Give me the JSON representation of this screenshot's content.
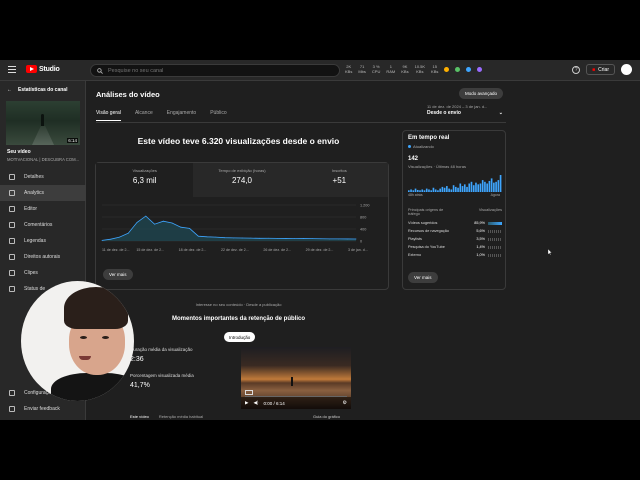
{
  "app": {
    "logo_text": "Studio",
    "search_placeholder": "Pesquise no seu canal",
    "create_label": "Criar",
    "help_glyph": "?"
  },
  "tray": {
    "items": [
      {
        "top": "2K",
        "bottom": "KBs"
      },
      {
        "top": "71",
        "bottom": "Mbs"
      },
      {
        "top": "3 %",
        "bottom": "CPU"
      },
      {
        "top": "1",
        "bottom": "RAM"
      },
      {
        "top": "9K",
        "bottom": "KBs"
      },
      {
        "top": "10.5K",
        "bottom": "KBs"
      },
      {
        "top": "15",
        "bottom": "KBs"
      }
    ]
  },
  "sidebar": {
    "header": "Estatísticas do canal",
    "thumb_duration": "6:14",
    "video_label": "Seu vídeo",
    "video_sub": "MOTIVACIONAL | DESCUBRA COM...",
    "items": [
      {
        "label": "Detalhes",
        "active": false
      },
      {
        "label": "Analytics",
        "active": true
      },
      {
        "label": "Editor",
        "active": false
      },
      {
        "label": "Comentários",
        "active": false
      },
      {
        "label": "Legendas",
        "active": false
      },
      {
        "label": "Direitos autorais",
        "active": false
      },
      {
        "label": "Clipes",
        "active": false
      },
      {
        "label": "Status de",
        "active": false
      }
    ],
    "bottom_items": [
      {
        "label": "Configurações"
      },
      {
        "label": "Enviar feedback"
      }
    ]
  },
  "main": {
    "title": "Análises do vídeo",
    "advanced_button": "Modo avançado",
    "tabs": [
      {
        "label": "Visão geral",
        "active": true
      },
      {
        "label": "Alcance",
        "active": false
      },
      {
        "label": "Engajamento",
        "active": false
      },
      {
        "label": "Público",
        "active": false
      }
    ],
    "date_range_top": "11 de dez. de 2024 – 3 de jan. d...",
    "date_range_main": "Desde o envio",
    "headline": "Este vídeo teve 6.320 visualizações desde o envio",
    "metrics": [
      {
        "label": "Visualizações",
        "value": "6,3 mil"
      },
      {
        "label": "Tempo de exibição (horas)",
        "value": "274,0"
      },
      {
        "label": "Inscritos",
        "value": "+51"
      }
    ],
    "see_more": "Ver mais",
    "footnote": "Interesse no seu conteúdo · Desde a publicação",
    "moments_title": "Momentos importantes da retenção de público",
    "intro_chip": "Introdução",
    "avg_duration_label": "Duração média da visualização",
    "avg_duration_value": "2:36",
    "avg_percent_label": "Porcentagem visualizada média",
    "avg_percent_value": "41,7%",
    "video_time": "0:00 / 6:14",
    "legend_this_video": "Este vídeo",
    "legend_typical": "Retenção média habitual",
    "chart_guide": "Guia do gráfico"
  },
  "realtime": {
    "title": "Em tempo real",
    "live_label": "Atualizando",
    "views_48h": "142",
    "sub_label": "Visualizações · Últimas 48 horas",
    "axis_left": "48h atrás",
    "axis_right": "Agora",
    "table_head_source": "Principais origens de tráfego",
    "table_head_views": "Visualizações",
    "sources": [
      {
        "name": "Vídeos sugeridos",
        "pct": "85,9%"
      },
      {
        "name": "Recursos de navegação",
        "pct": "5,6%"
      },
      {
        "name": "Playlists",
        "pct": "3,5%"
      },
      {
        "name": "Pesquisa do YouTube",
        "pct": "1,4%"
      },
      {
        "name": "Externo",
        "pct": "1,0%"
      }
    ],
    "see_more": "Ver mais",
    "bar_values": [
      0.1,
      0.15,
      0.1,
      0.2,
      0.12,
      0.1,
      0.15,
      0.1,
      0.2,
      0.15,
      0.1,
      0.25,
      0.15,
      0.1,
      0.2,
      0.3,
      0.25,
      0.35,
      0.2,
      0.15,
      0.4,
      0.3,
      0.25,
      0.5,
      0.35,
      0.45,
      0.3,
      0.5,
      0.6,
      0.4,
      0.55,
      0.45,
      0.5,
      0.7,
      0.6,
      0.5,
      0.65,
      0.8,
      0.55,
      0.6,
      0.7,
      1.0
    ]
  },
  "chart_data": {
    "type": "area",
    "x": [
      "11 de dez. de 2...",
      "15 de dez. de 2...",
      "18 de dez. de 2...",
      "22 de dez. de 2...",
      "26 de dez. de 2...",
      "29 de dez. de 2...",
      "3 de jan. d..."
    ],
    "series": [
      {
        "values": [
          20,
          60,
          130,
          260,
          620,
          830,
          560,
          660,
          600,
          460,
          420,
          160,
          140,
          130,
          110,
          105,
          100,
          95,
          90,
          92,
          88,
          85,
          80,
          82,
          78,
          76,
          72,
          70,
          68,
          66
        ]
      }
    ],
    "yticks": [
      "0",
      "400",
      "800",
      "1.200"
    ],
    "ylim": [
      0,
      1200
    ],
    "color": "#3ea6ff"
  }
}
